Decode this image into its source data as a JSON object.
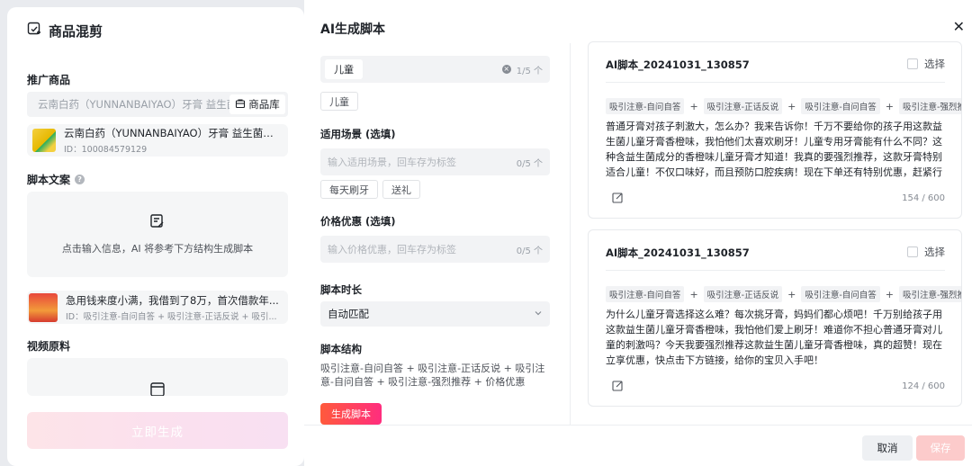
{
  "left_panel": {
    "title": "商品混剪",
    "promo_label": "推广商品",
    "product_search_value": "云南白药（YUNNANBAIYAO）牙膏 益生菌儿童牙膏",
    "product_library_label": "商品库",
    "product_card": {
      "name": "云南白药（YUNNANBAIYAO）牙膏 益生菌儿...",
      "id": "ID：100084579129"
    },
    "script_label": "脚本文案",
    "script_hint": "点击输入信息，AI 将参考下方结构生成脚本",
    "script_card": {
      "title": "急用钱来度小满，我借到了8万，首次借款年...",
      "sub": "ID：吸引注意-自问自答 + 吸引注意-正话反说 + 吸引..."
    },
    "video_label": "视频原料",
    "generate_button": "立即生成"
  },
  "dialog": {
    "title": "AI生成脚本",
    "audience_chip": "儿童",
    "audience_count": "1/5 个",
    "audience_tags": [
      "儿童"
    ],
    "scene_label": "适用场景 (选填)",
    "scene_placeholder": "输入适用场景，回车存为标签",
    "scene_count": "0/5 个",
    "scene_tags": [
      "每天刷牙",
      "送礼"
    ],
    "price_label": "价格优惠 (选填)",
    "price_placeholder": "输入价格优惠，回车存为标签",
    "price_count": "0/5 个",
    "duration_label": "脚本时长",
    "duration_value": "自动匹配",
    "structure_label": "脚本结构",
    "structure_text": "吸引注意-自问自答 + 吸引注意-正话反说 + 吸引注意-自问自答 + 吸引注意-强烈推荐 + 价格优惠",
    "generate_script_button": "生成脚本",
    "cancel_button": "取消",
    "save_button": "保存"
  },
  "results": [
    {
      "title": "AI脚本_20241031_130857",
      "select_label": "选择",
      "tags": [
        "吸引注意-自问自答",
        "吸引注意-正话反说",
        "吸引注意-自问自答",
        "吸引注意-强烈推荐"
      ],
      "text": "普通牙膏对孩子刺激大，怎么办？我来告诉你！千万不要给你的孩子用这款益生菌儿童牙膏香橙味，我怕他们太喜欢刷牙！儿童专用牙膏能有什么不同？这种含益生菌成分的香橙味儿童牙膏才知道！我真的要强烈推荐，这款牙膏特别适合儿童！不仅口味好，而且预防口腔疾病！现在下单还有特别优惠，赶紧行动起来，给孩子一个健康的口腔环境吧！",
      "count": "154 / 600"
    },
    {
      "title": "AI脚本_20241031_130857",
      "select_label": "选择",
      "tags": [
        "吸引注意-自问自答",
        "吸引注意-正话反说",
        "吸引注意-自问自答",
        "吸引注意-强烈推荐"
      ],
      "text": "为什么儿童牙膏选择这么难？每次挑牙膏，妈妈们都心烦吧！千万别给孩子用这款益生菌儿童牙膏香橙味，我怕他们爱上刷牙！难道你不担心普通牙膏对儿童的刺激吗？今天我要强烈推荐这款益生菌儿童牙膏香橙味，真的超赞！现在立享优惠，快点击下方链接，给你的宝贝入手吧！",
      "count": "124 / 600"
    }
  ],
  "colors": {
    "accent_gradient_start": "#ff5a3c",
    "accent_gradient_end": "#ff2d7e",
    "save_disabled": "#fccbcb"
  }
}
